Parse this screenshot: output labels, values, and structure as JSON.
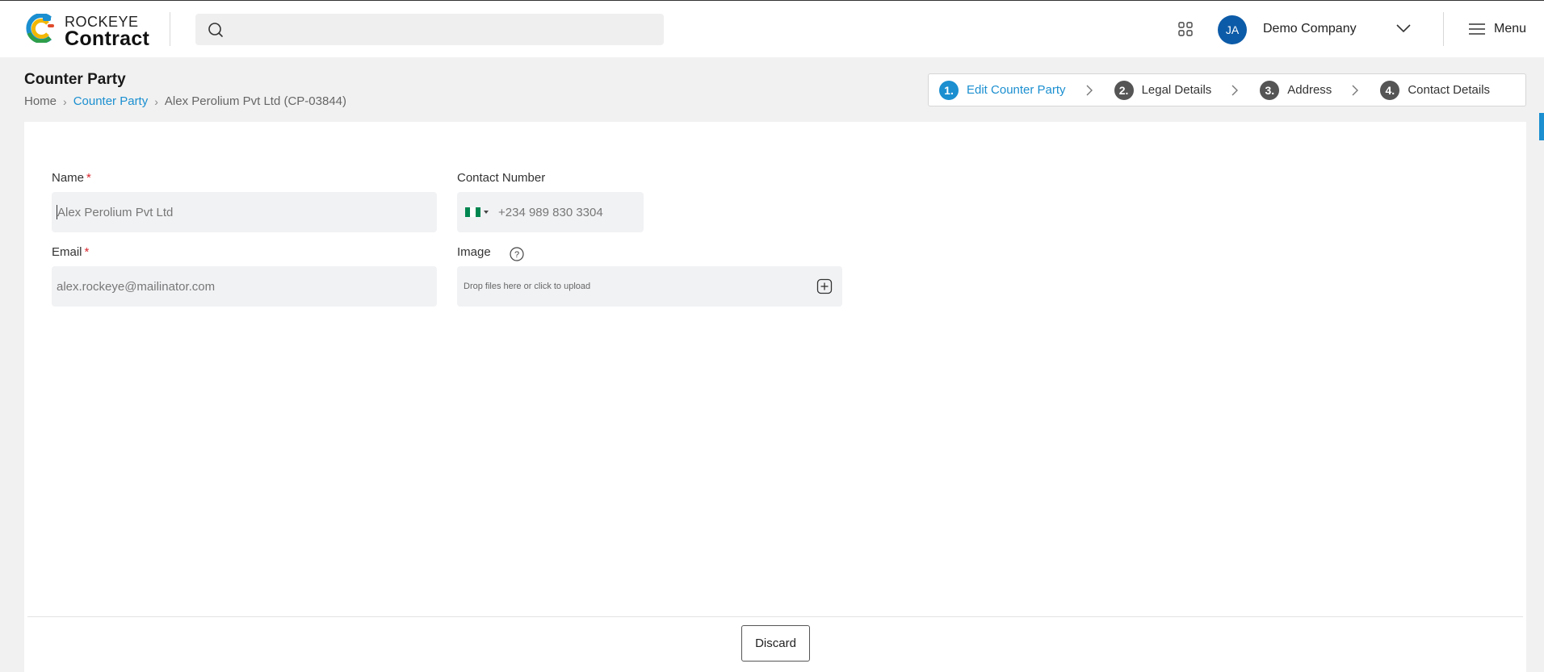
{
  "header": {
    "brand_top": "ROCKEYE",
    "brand_bottom": "Contract",
    "search_placeholder": "",
    "avatar_initials": "JA",
    "company_name": "Demo Company",
    "menu_label": "Menu"
  },
  "page": {
    "title": "Counter Party",
    "breadcrumb": {
      "home": "Home",
      "section": "Counter Party",
      "current": "Alex Perolium Pvt Ltd (CP-03844)"
    }
  },
  "stepper": {
    "steps": [
      {
        "num": "1.",
        "label": "Edit Counter Party",
        "active": true
      },
      {
        "num": "2.",
        "label": "Legal Details",
        "active": false
      },
      {
        "num": "3.",
        "label": "Address",
        "active": false
      },
      {
        "num": "4.",
        "label": "Contact Details",
        "active": false
      }
    ]
  },
  "form": {
    "name_label": "Name",
    "name_value": "Alex Perolium Pvt Ltd",
    "contact_label": "Contact Number",
    "contact_value": "+234 989 830 3304",
    "email_label": "Email",
    "email_value": "alex.rockeye@mailinator.com",
    "image_label": "Image",
    "upload_text": "Drop files here or click to upload",
    "required_mark": "*"
  },
  "footer": {
    "discard_label": "Discard"
  },
  "colors": {
    "accent": "#1b8fd0",
    "avatar": "#0c5ba8",
    "required": "#d9282f",
    "flag_green": "#008751"
  },
  "icons": [
    "logo-icon",
    "search-icon",
    "apps-grid-icon",
    "chevron-down-icon",
    "hamburger-icon",
    "chevron-right-icon",
    "help-icon",
    "add-file-icon",
    "nigeria-flag-icon"
  ]
}
